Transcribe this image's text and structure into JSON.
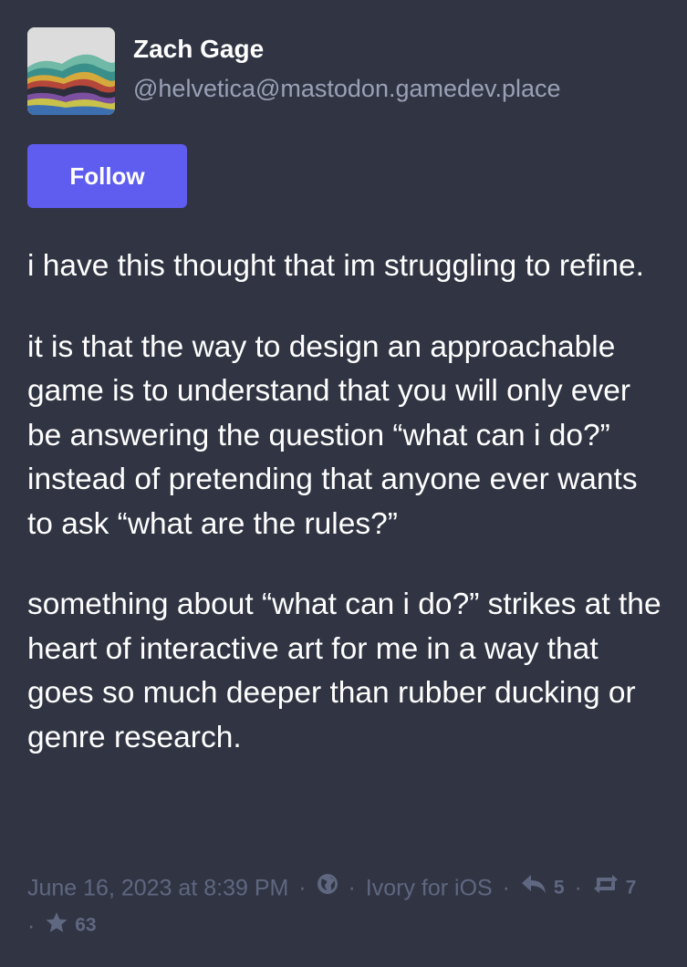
{
  "account": {
    "display_name": "Zach Gage",
    "handle": "@helvetica@mastodon.gamedev.place"
  },
  "follow_button": {
    "label": "Follow"
  },
  "post": {
    "paragraphs": [
      "i have this thought that im struggling to refine.",
      "it is that the way to design an approachable game is to understand that you will only ever be answering the question “what can i do?” instead of pretending that anyone ever wants to ask “what are the rules?”",
      "something about “what can i do?” strikes at the heart of interactive art for me in a way that goes so much deeper than rubber ducking or genre research."
    ]
  },
  "meta": {
    "timestamp": "June 16, 2023 at 8:39 PM",
    "separator": "·",
    "visibility_icon": "globe-icon",
    "application": "Ivory for iOS",
    "replies_icon": "reply-icon",
    "replies_count": "5",
    "boosts_icon": "boost-icon",
    "boosts_count": "7",
    "favourites_icon": "star-icon",
    "favourites_count": "63"
  },
  "colors": {
    "background": "#313543",
    "accent": "#5f5cf0",
    "text": "#ffffff",
    "handle": "#9aa0b6",
    "meta": "#5f6781"
  }
}
